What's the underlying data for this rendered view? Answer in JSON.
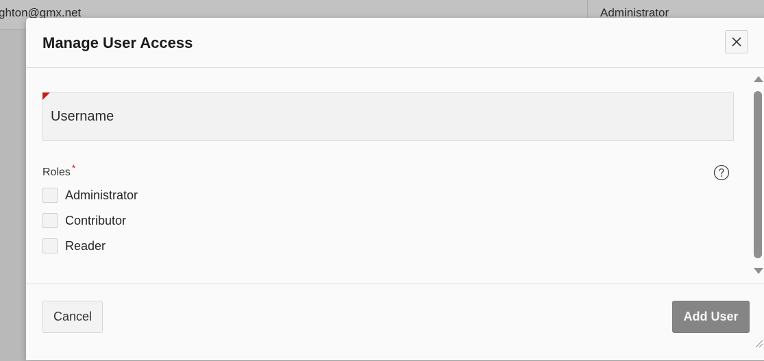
{
  "background": {
    "email_fragment": "ghton@gmx.net",
    "role_value": "Administrator"
  },
  "dialog": {
    "title": "Manage User Access",
    "close_icon": "close-icon",
    "username": {
      "placeholder": "Username",
      "value": "",
      "required": true
    },
    "roles": {
      "label": "Roles",
      "required_marker": "*",
      "help_icon": "question-circle-icon",
      "options": [
        {
          "label": "Administrator",
          "checked": false
        },
        {
          "label": "Contributor",
          "checked": false
        },
        {
          "label": "Reader",
          "checked": false
        }
      ]
    },
    "footer": {
      "cancel_label": "Cancel",
      "add_user_label": "Add User"
    }
  },
  "colors": {
    "required_red": "#cc1818",
    "primary_disabled": "#858585"
  }
}
